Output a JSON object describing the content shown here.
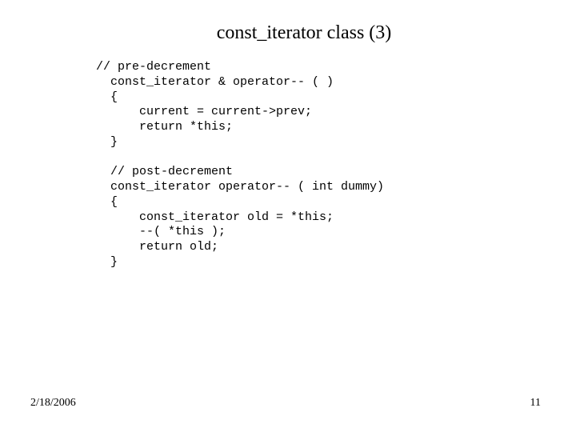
{
  "title": "const_iterator class (3)",
  "code": "// pre-decrement\n  const_iterator & operator-- ( )\n  {\n      current = current->prev;\n      return *this;\n  }\n\n  // post-decrement\n  const_iterator operator-- ( int dummy)\n  {\n      const_iterator old = *this;\n      --( *this );\n      return old;\n  }",
  "footer": {
    "date": "2/18/2006",
    "page": "11"
  }
}
